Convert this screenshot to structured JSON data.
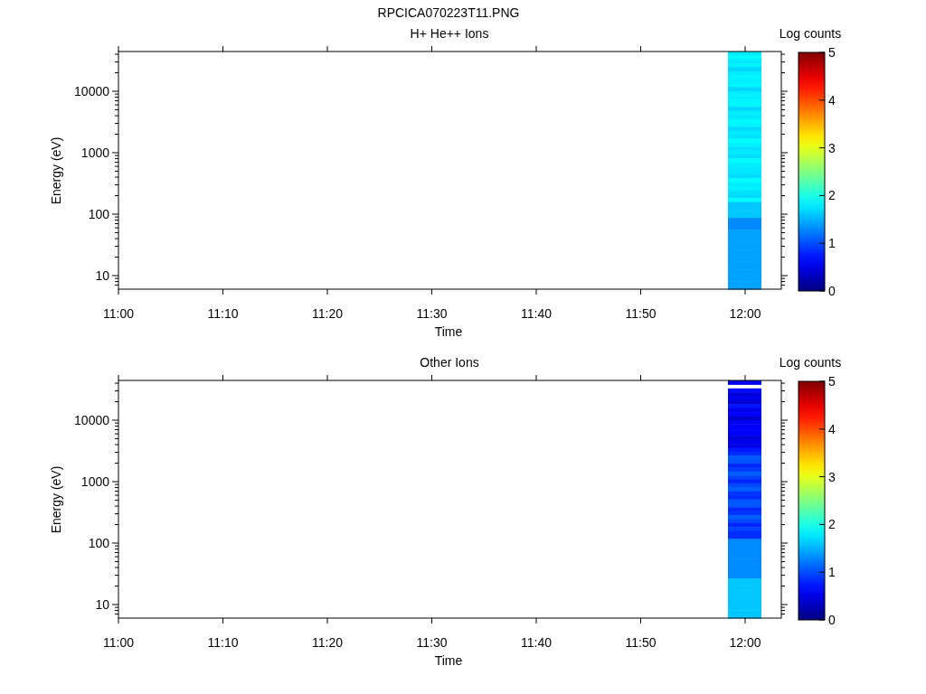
{
  "title": "RPCICA070223T11.PNG",
  "panels": [
    {
      "title": "H+ He++ Ions",
      "y_axis": {
        "label": "Energy (eV)",
        "ticks": [
          "10000",
          "1000",
          "100",
          "10"
        ]
      },
      "x_axis": {
        "label": "Time",
        "ticks": [
          "11:00",
          "11:10",
          "11:20",
          "11:30",
          "11:40",
          "11:50",
          "12:00"
        ]
      },
      "colorbar": {
        "title": "Log counts",
        "ticks": [
          "5",
          "4",
          "3",
          "2",
          "1",
          "0"
        ]
      }
    },
    {
      "title": "Other Ions",
      "y_axis": {
        "label": "Energy (eV)",
        "ticks": [
          "10000",
          "1000",
          "100",
          "10"
        ]
      },
      "x_axis": {
        "label": "Time",
        "ticks": [
          "11:00",
          "11:10",
          "11:20",
          "11:30",
          "11:40",
          "11:50",
          "12:00"
        ]
      },
      "colorbar": {
        "title": "Log counts",
        "ticks": [
          "5",
          "4",
          "3",
          "2",
          "1",
          "0"
        ]
      }
    }
  ]
}
